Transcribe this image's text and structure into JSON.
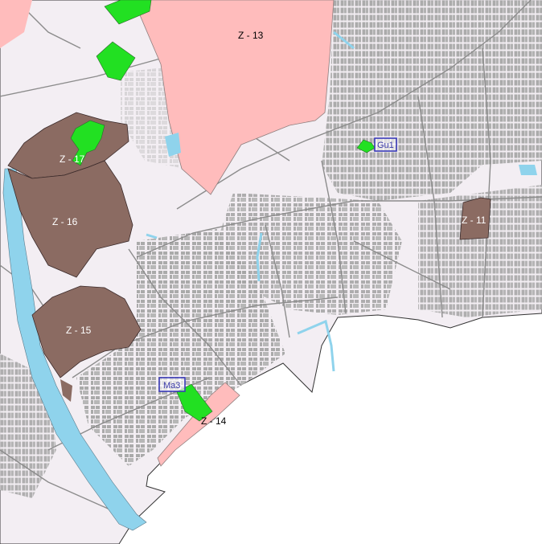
{
  "map": {
    "colors": {
      "urban_fabric": "#f3eef3",
      "outside": "#ffffff",
      "buildings": "#a6a6a6",
      "streets": "#9a9a9a",
      "zone_pink": "#ffbcbc",
      "zone_brown": "#8b6b62",
      "green_area": "#22e022",
      "water": "#8fd3ec",
      "label_box": "#3a3ab8"
    },
    "zones": [
      {
        "id": "z13",
        "label": "Z - 13"
      },
      {
        "id": "z17",
        "label": "Z - 17"
      },
      {
        "id": "z16",
        "label": "Z - 16"
      },
      {
        "id": "z15",
        "label": "Z - 15"
      },
      {
        "id": "z11",
        "label": "Z - 11"
      },
      {
        "id": "z14",
        "label": "Z - 14"
      }
    ],
    "boxed_labels": [
      {
        "id": "gu1",
        "label": "Gu1"
      },
      {
        "id": "ma3",
        "label": "Ma3"
      }
    ]
  }
}
